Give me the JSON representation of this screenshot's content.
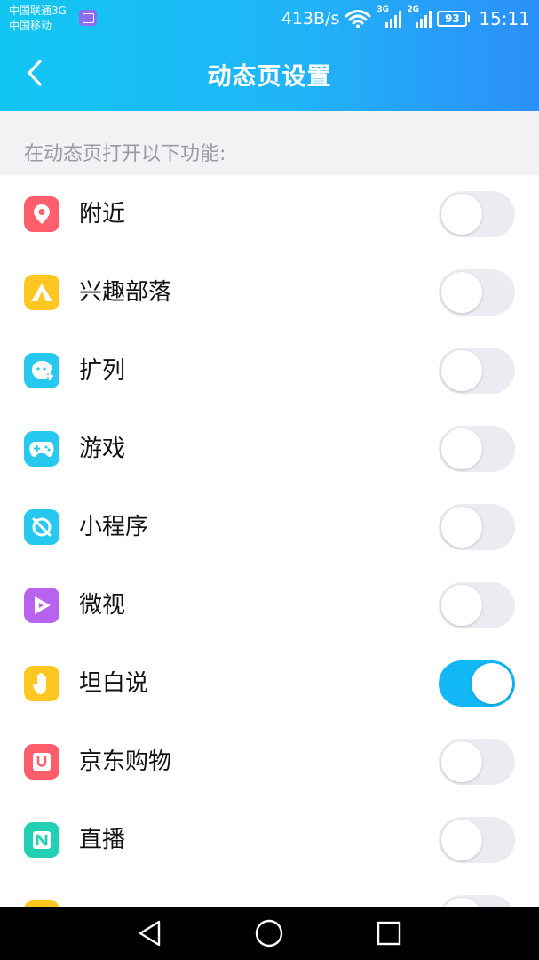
{
  "status_bar": {
    "carrier1": "中国联通3G",
    "carrier2": "中国移动",
    "net_speed": "413B/s",
    "signal1_tag": "3G",
    "signal2_tag": "2G",
    "battery": "93",
    "time": "15:11"
  },
  "header": {
    "title": "动态页设置",
    "back_icon": "chevron-left-icon"
  },
  "section": {
    "title": "在动态页打开以下功能:"
  },
  "features": [
    {
      "label": "附近",
      "icon": "location-pin-icon",
      "color": "#ff5e6c",
      "enabled": false
    },
    {
      "label": "兴趣部落",
      "icon": "tent-icon",
      "color": "#ffc71f",
      "enabled": false
    },
    {
      "label": "扩列",
      "icon": "add-friend-face-icon",
      "color": "#27c8f0",
      "enabled": false
    },
    {
      "label": "游戏",
      "icon": "gamepad-icon",
      "color": "#27c8f0",
      "enabled": false
    },
    {
      "label": "小程序",
      "icon": "mini-program-icon",
      "color": "#27c8f0",
      "enabled": false
    },
    {
      "label": "微视",
      "icon": "play-icon",
      "color": "#b863f0",
      "enabled": false
    },
    {
      "label": "坦白说",
      "icon": "hand-icon",
      "color": "#ffc71f",
      "enabled": true
    },
    {
      "label": "京东购物",
      "icon": "shopping-bag-icon",
      "color": "#ff5e6c",
      "enabled": false
    },
    {
      "label": "直播",
      "icon": "live-icon",
      "color": "#22d1b5",
      "enabled": false
    },
    {
      "label": "",
      "icon": "partial-icon",
      "color": "#ffc71f",
      "enabled": false
    }
  ],
  "colors": {
    "accent": "#12b7f5",
    "toggle_off": "#ebecf1"
  }
}
